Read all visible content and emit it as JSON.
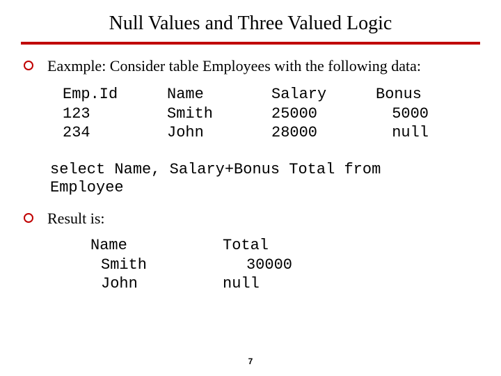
{
  "title": "Null Values and Three Valued Logic",
  "intro": "Eaxmple: Consider table Employees with the following data:",
  "table1": {
    "h": {
      "emp": "Emp.Id",
      "name": "Name",
      "salary": "Salary",
      "bonus": "Bonus"
    },
    "r1": {
      "emp": "123",
      "name": "Smith",
      "salary": "25000",
      "bonus": "5000"
    },
    "r2": {
      "emp": "234",
      "name": "John",
      "salary": "28000",
      "bonus": "null"
    }
  },
  "sql_line1": "select Name, Salary+Bonus Total from",
  "sql_line2": "Employee",
  "result_label": "Result is:",
  "table2": {
    "h": {
      "name": "Name",
      "total": "Total"
    },
    "r1": {
      "name": "Smith",
      "total": "30000"
    },
    "r2": {
      "name": "John",
      "total": "null"
    }
  },
  "page": "7"
}
